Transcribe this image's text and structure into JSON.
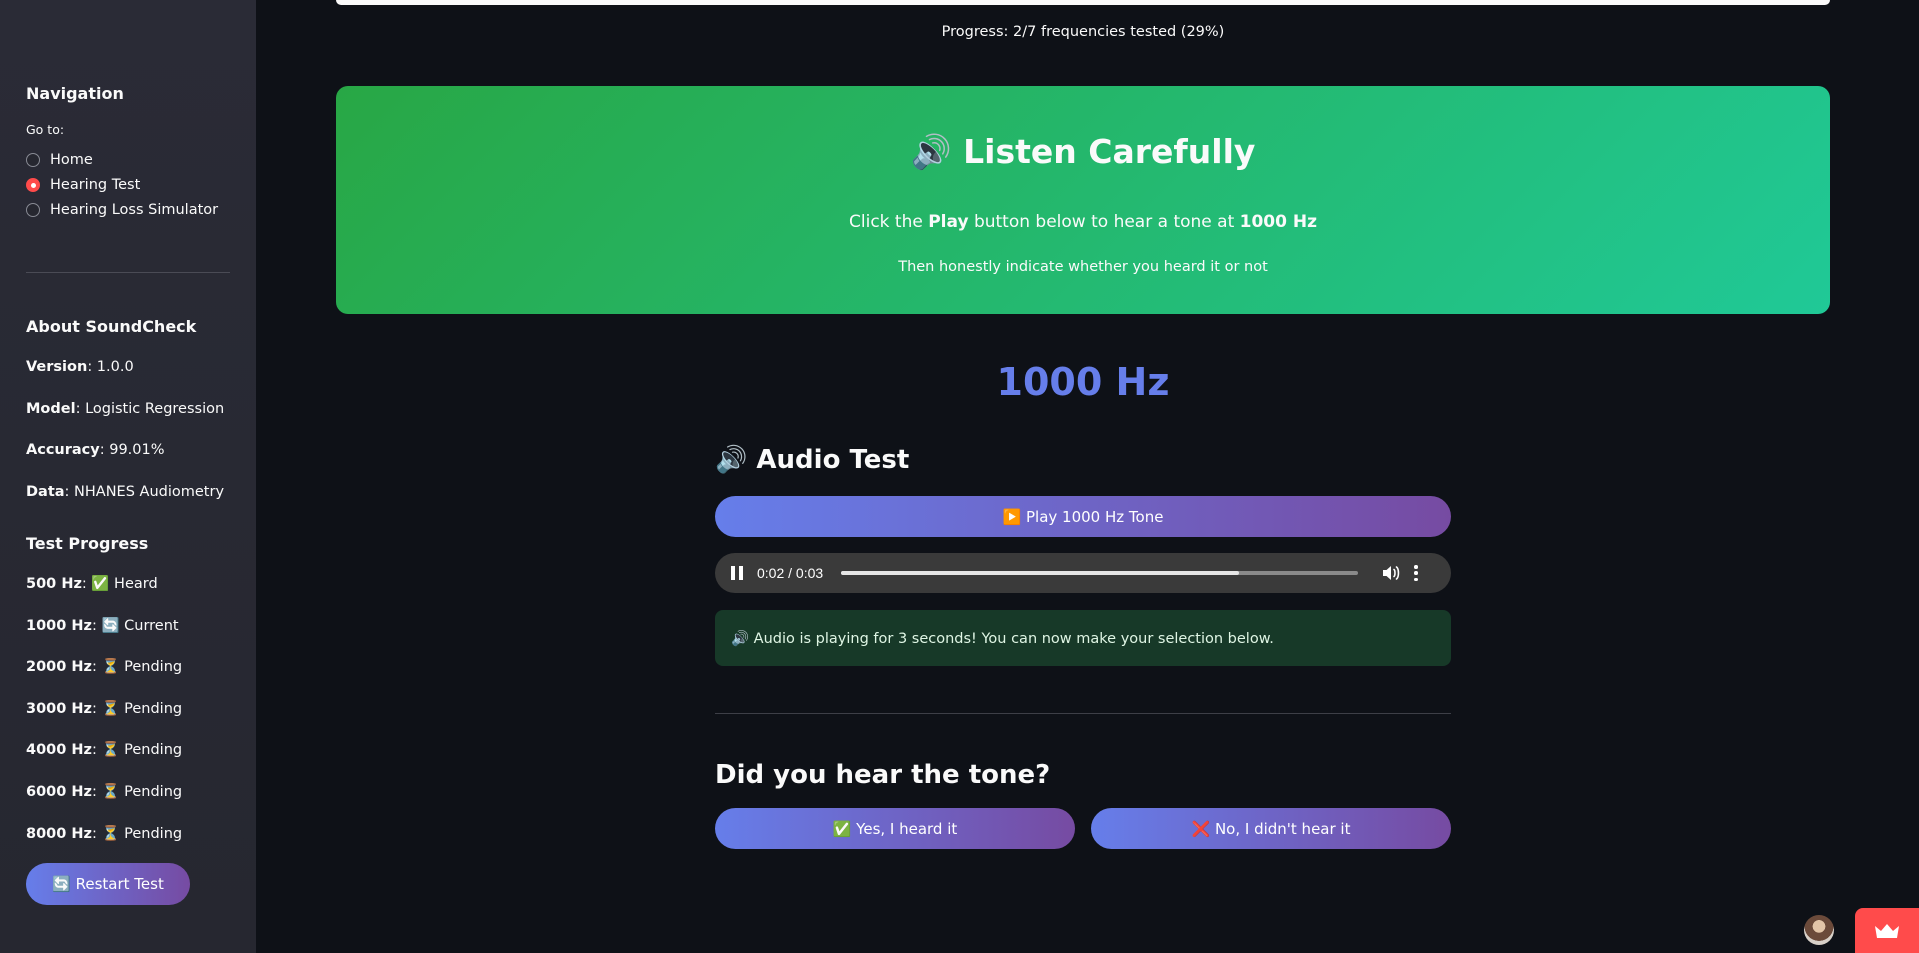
{
  "sidebar": {
    "navigation_heading": "Navigation",
    "goto_label": "Go to:",
    "nav_options": [
      {
        "label": "Home",
        "selected": false
      },
      {
        "label": "Hearing Test",
        "selected": true
      },
      {
        "label": "Hearing Loss Simulator",
        "selected": false
      }
    ],
    "about_heading": "About SoundCheck",
    "about": [
      {
        "key": "Version",
        "value": ": 1.0.0"
      },
      {
        "key": "Model",
        "value": ": Logistic Regression"
      },
      {
        "key": "Accuracy",
        "value": ": 99.01%"
      },
      {
        "key": "Data",
        "value": ": NHANES Audiometry"
      }
    ],
    "progress_heading": "Test Progress",
    "progress": [
      {
        "key": "500 Hz",
        "value": ": ✅ Heard"
      },
      {
        "key": "1000 Hz",
        "value": ": 🔄 Current"
      },
      {
        "key": "2000 Hz",
        "value": ": ⏳ Pending"
      },
      {
        "key": "3000 Hz",
        "value": ": ⏳ Pending"
      },
      {
        "key": "4000 Hz",
        "value": ": ⏳ Pending"
      },
      {
        "key": "6000 Hz",
        "value": ": ⏳ Pending"
      },
      {
        "key": "8000 Hz",
        "value": ": ⏳ Pending"
      }
    ],
    "restart_label": "🔄 Restart Test"
  },
  "main": {
    "progress_text": "Progress: 2/7 frequencies tested (29%)",
    "hero": {
      "title": "🔊 Listen Carefully",
      "line1_pre": "Click the ",
      "line1_bold1": "Play",
      "line1_mid": " button below to hear a tone at ",
      "line1_bold2": "1000 Hz",
      "line2": "Then honestly indicate whether you heard it or not"
    },
    "frequency_display": "1000 Hz",
    "audio_heading": "🔊 Audio Test",
    "play_label": "▶️ Play 1000 Hz Tone",
    "player": {
      "time": "0:02 / 0:03",
      "progress": 0.77
    },
    "alert_text": "🔊 Audio is playing for 3 seconds! You can now make your selection below.",
    "question": "Did you hear the tone?",
    "yes_label": "✅ Yes, I heard it",
    "no_label": "❌ No, I didn't hear it"
  },
  "colors": {
    "accent": "#667eea",
    "accent_end": "#764ba2",
    "hero_start": "#28a745",
    "hero_end": "#20c997",
    "radio_selected": "#ff4b4b"
  }
}
